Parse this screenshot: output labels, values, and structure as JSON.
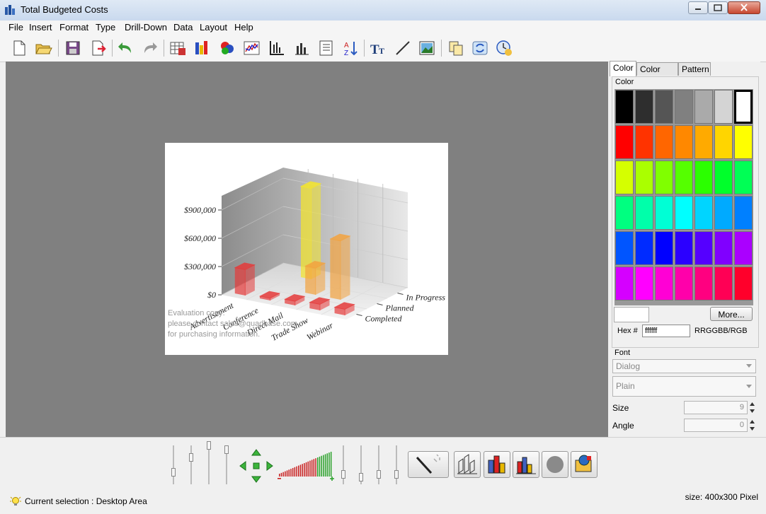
{
  "window": {
    "title": "Total Budgeted Costs"
  },
  "menu": [
    "File",
    "Insert",
    "Format",
    "Type",
    "Drill-Down",
    "Data",
    "Layout",
    "Help"
  ],
  "chart_data": {
    "type": "bar",
    "categories": [
      "Advertisement",
      "Conference",
      "Direct Mail",
      "Trade Show",
      "Webinar"
    ],
    "series": [
      {
        "name": "In Progress",
        "values": [
          0,
          960000,
          0,
          0,
          0
        ]
      },
      {
        "name": "Planned",
        "values": [
          0,
          0,
          280000,
          620000,
          0
        ]
      },
      {
        "name": "Completed",
        "values": [
          270000,
          20000,
          40000,
          60000,
          60000
        ]
      }
    ],
    "ylabel_ticks": [
      "$0",
      "$300,000",
      "$600,000",
      "$900,000"
    ],
    "ylim": [
      0,
      1050000
    ],
    "colors": {
      "In Progress": "#f5e62a",
      "Planned": "#f3a33f",
      "Completed": "#e53a3a"
    },
    "watermark": [
      "Evaluation copy:",
      "please contact sales@quadbase.com",
      "for purchasing information."
    ]
  },
  "tabs": [
    "Color",
    "Color Set",
    "Pattern"
  ],
  "color_panel": {
    "group_label": "Color",
    "more_label": "More...",
    "hex_label": "Hex #",
    "hex_value": "ffffff",
    "format_label": "RRGGBB/RGB",
    "palette": [
      [
        "#000000",
        "#2e2e2e",
        "#555555",
        "#808080",
        "#aaaaaa",
        "#d4d4d4",
        "#ffffff"
      ],
      [
        "#ff0000",
        "#ff3300",
        "#ff6600",
        "#ff8800",
        "#ffaa00",
        "#ffd500",
        "#ffff00"
      ],
      [
        "#d5ff00",
        "#aaff00",
        "#80ff00",
        "#55ff00",
        "#2bff00",
        "#00ff2b",
        "#00ff55"
      ],
      [
        "#00ff80",
        "#00ffaa",
        "#00ffd5",
        "#00ffff",
        "#00d5ff",
        "#00aaff",
        "#0080ff"
      ],
      [
        "#0055ff",
        "#002bff",
        "#0000ff",
        "#2b00ff",
        "#5500ff",
        "#8000ff",
        "#aa00ff"
      ],
      [
        "#d500ff",
        "#ff00ff",
        "#ff00d5",
        "#ff00aa",
        "#ff0080",
        "#ff0055",
        "#ff002b"
      ]
    ]
  },
  "font_panel": {
    "label": "Font",
    "family": "Dialog",
    "style": "Plain",
    "size_label": "Size",
    "size_value": "9",
    "angle_label": "Angle",
    "angle_value": "0"
  },
  "status": {
    "selection": "Current selection : Desktop Area",
    "size": "size: 400x300 Pixel"
  }
}
